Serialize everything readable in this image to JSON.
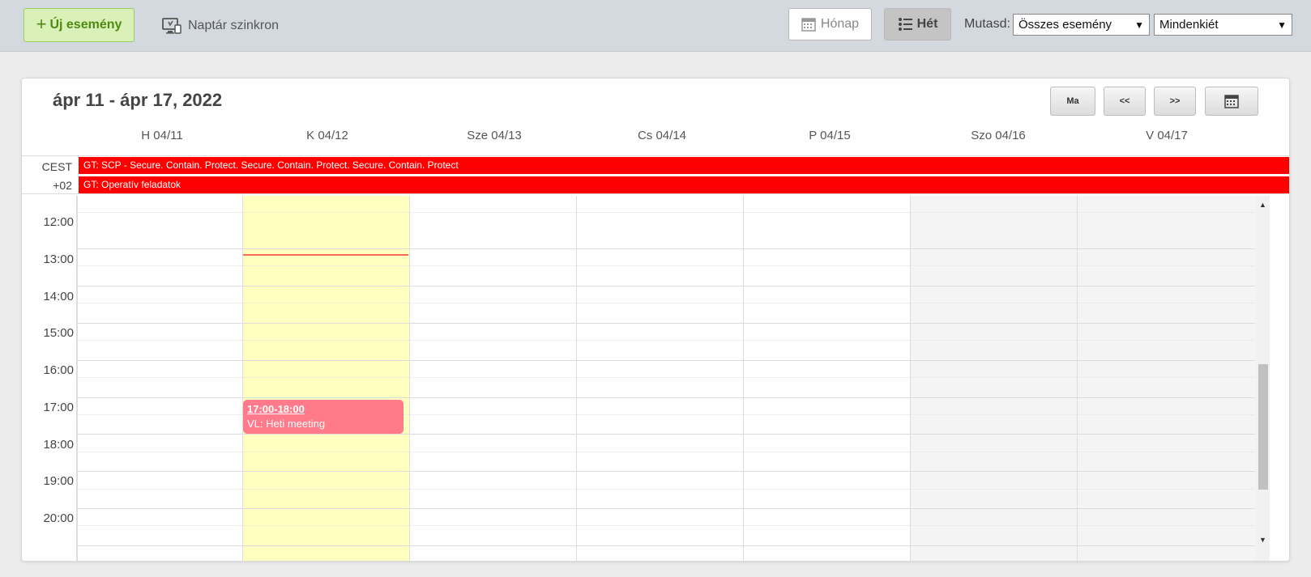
{
  "toolbar": {
    "new_event_label": "Új esemény",
    "sync_label": "Naptár szinkron",
    "month_label": "Hónap",
    "week_label": "Hét",
    "show_label": "Mutasd:",
    "event_filter": "Összes esemény",
    "people_filter": "Mindenkiét"
  },
  "calendar": {
    "range_title": "ápr 11 - ápr 17, 2022",
    "nav": {
      "today": "Ma",
      "prev": "<<",
      "next": ">>"
    },
    "days": [
      "H 04/11",
      "K 04/12",
      "Sze 04/13",
      "Cs 04/14",
      "P 04/15",
      "Szo 04/16",
      "V 04/17"
    ],
    "timezone": {
      "line1": "CEST",
      "line2": "+02"
    },
    "allday_events": [
      "GT: SCP - Secure. Contain. Protect. Secure. Contain. Protect. Secure. Contain. Protect",
      "GT: Operatív feladatok"
    ],
    "hours": [
      "12:00",
      "13:00",
      "14:00",
      "15:00",
      "16:00",
      "17:00",
      "18:00",
      "19:00",
      "20:00"
    ],
    "events": [
      {
        "time": "17:00-18:00",
        "title": "VL: Heti meeting",
        "day": "K 04/12"
      }
    ]
  },
  "colors": {
    "allday_event": "#ff0000",
    "event": "#ff7a8a",
    "today_column": "#ffffc0",
    "now_line": "#ff6a5c"
  }
}
